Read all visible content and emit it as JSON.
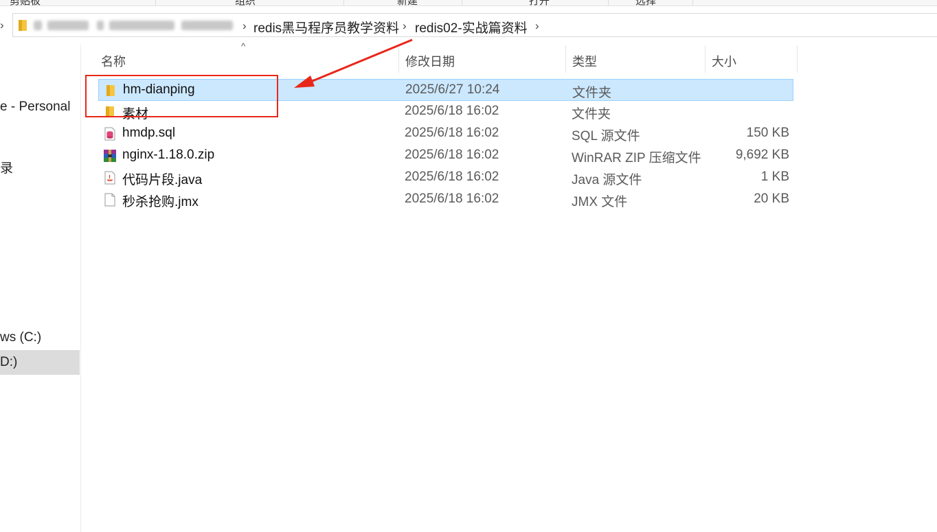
{
  "ribbon": {
    "labels": [
      "剪贴板",
      "组织",
      "新建",
      "打开",
      "选择"
    ]
  },
  "address": {
    "breadcrumbs": [
      "redis黑马程序员教学资料",
      "redis02-实战篇资料"
    ]
  },
  "nav": {
    "items": [
      "e - Personal",
      "录",
      "ws (C:)",
      "D:)"
    ]
  },
  "columns": {
    "name": "名称",
    "date": "修改日期",
    "type": "类型",
    "size": "大小"
  },
  "files": [
    {
      "name": "hm-dianping",
      "date": "2025/6/27 10:24",
      "type": "文件夹",
      "size": "",
      "icon": "folder-icon"
    },
    {
      "name": "素材",
      "date": "2025/6/18 16:02",
      "type": "文件夹",
      "size": "",
      "icon": "folder-icon"
    },
    {
      "name": "hmdp.sql",
      "date": "2025/6/18 16:02",
      "type": "SQL 源文件",
      "size": "150 KB",
      "icon": "sql-file-icon"
    },
    {
      "name": "nginx-1.18.0.zip",
      "date": "2025/6/18 16:02",
      "type": "WinRAR ZIP 压缩文件",
      "size": "9,692 KB",
      "icon": "winrar-archive-icon"
    },
    {
      "name": "代码片段.java",
      "date": "2025/6/18 16:02",
      "type": "Java 源文件",
      "size": "1 KB",
      "icon": "java-file-icon"
    },
    {
      "name": "秒杀抢购.jmx",
      "date": "2025/6/18 16:02",
      "type": "JMX 文件",
      "size": "20 KB",
      "icon": "generic-file-icon"
    }
  ],
  "colors": {
    "selection": "#cce8ff",
    "annotation": "#e8271a"
  }
}
